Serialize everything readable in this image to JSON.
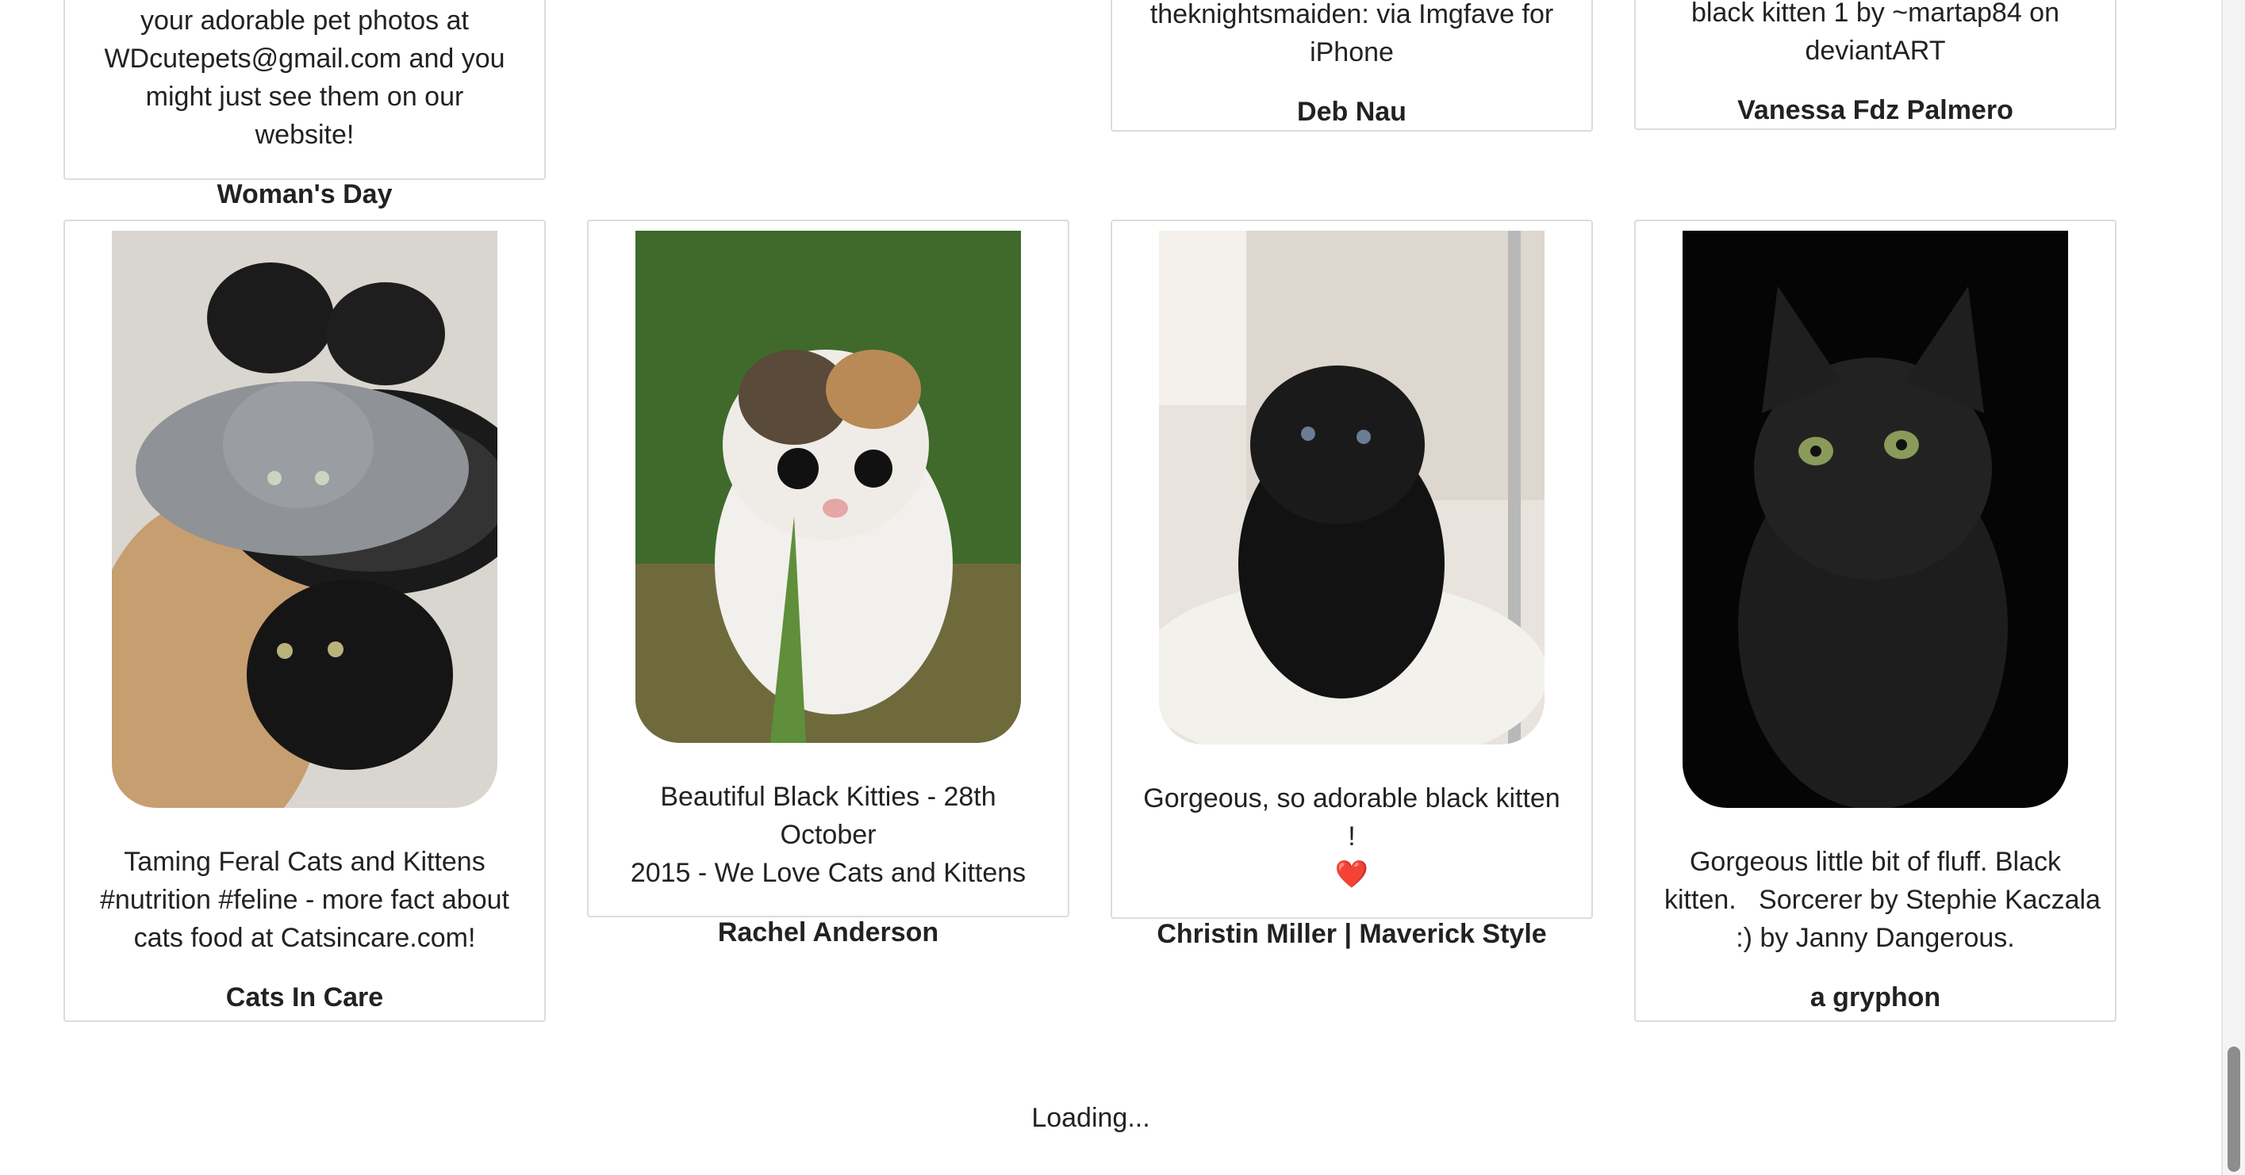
{
  "top_row": [
    {
      "caption_lines": [
        "your adorable pet photos at",
        "WDcutepets@gmail.com and you",
        "might just see them on our website!"
      ],
      "author": "Woman's Day"
    },
    {
      "caption_lines": [
        "theknightsmaiden: via Imgfave for",
        "iPhone"
      ],
      "author": "Deb Nau"
    },
    {
      "caption_lines": [
        "black kitten 1 by ~martap84 on",
        "deviantART"
      ],
      "author": "Vanessa Fdz Palmero"
    }
  ],
  "cards": [
    {
      "image": "black-and-grey-kittens-in-pot-photo",
      "caption_lines": [
        "Taming Feral Cats and Kittens",
        "#nutrition #feline - more fact about",
        "cats food at Catsincare.com!"
      ],
      "author": "Cats In Care"
    },
    {
      "image": "calico-kitten-in-grass-photo",
      "caption_lines": [
        "Beautiful Black Kitties - 28th October",
        "2015 - We Love Cats and Kittens"
      ],
      "author": "Rachel Anderson"
    },
    {
      "image": "fluffy-black-kitten-on-chair-photo",
      "caption_lines": [
        "Gorgeous, so adorable black kitten !",
        "❤️"
      ],
      "author": "Christin Miller | Maverick Style"
    },
    {
      "image": "dark-fluffy-kitten-photo",
      "caption_lines": [
        "Gorgeous little bit of fluff. Black",
        "kitten.   Sorcerer by Stephie Kaczala",
        ":) by Janny Dangerous."
      ],
      "author": "a gryphon"
    }
  ],
  "status": {
    "loading_text": "Loading..."
  },
  "colors": {
    "card_border": "#dcdcdc",
    "text": "#222222",
    "background": "#ffffff"
  }
}
